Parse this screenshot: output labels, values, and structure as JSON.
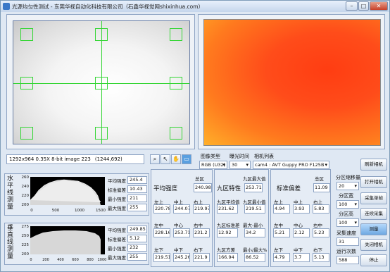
{
  "window": {
    "title": "光源均匀性测试 - 东莞华视自动化科技有限公司（石鑫华视觉网shixinhua.com）",
    "minimize": "–",
    "maximize": "□",
    "close": "✕"
  },
  "status": {
    "image_info": "1292x964 0.35X 8-bit image 223",
    "coords": "(1244,692)"
  },
  "tools": [
    "zoom-icon",
    "pointer-icon",
    "pan-icon",
    "roi-icon"
  ],
  "camera": {
    "type_label": "图像类型",
    "type_value": "RGB (U32)",
    "exposure_label": "曝光时间",
    "exposure_value": "30",
    "list_label": "相机列表",
    "camera_value": "cam4 : AVT Guppy PRO F125B",
    "refresh": "刷新相机"
  },
  "horizontal_profile": {
    "label": "水平线测量",
    "y_ticks": [
      "260",
      "240",
      "220",
      "200"
    ],
    "x_ticks": [
      "0",
      "500",
      "1000",
      "1500"
    ],
    "stats": [
      {
        "k": "平均强度",
        "v": "245.4"
      },
      {
        "k": "标准偏差",
        "v": "10.43"
      },
      {
        "k": "最小强度",
        "v": "211"
      },
      {
        "k": "最大强度",
        "v": "255"
      }
    ]
  },
  "vertical_profile": {
    "label": "垂直线测量",
    "y_ticks": [
      "275",
      "250",
      "225",
      "200"
    ],
    "x_ticks": [
      "0",
      "200",
      "400",
      "600",
      "800",
      "1000"
    ],
    "stats": [
      {
        "k": "平均强度",
        "v": "249.85"
      },
      {
        "k": "标准偏差",
        "v": "5.12"
      },
      {
        "k": "最小强度",
        "v": "232"
      },
      {
        "k": "最大强度",
        "v": "255"
      }
    ]
  },
  "avg_intensity": {
    "title": "平均强度",
    "total_label": "总区",
    "total": "240.98",
    "cells": [
      {
        "k": "左上",
        "v": "220.78"
      },
      {
        "k": "中上",
        "v": "244.07"
      },
      {
        "k": "右上",
        "v": "219.97"
      },
      {
        "k": "左中",
        "v": "228.16"
      },
      {
        "k": "中心",
        "v": "253.71"
      },
      {
        "k": "右中",
        "v": "231.2"
      },
      {
        "k": "左下",
        "v": "219.51"
      },
      {
        "k": "中下",
        "v": "245.26"
      },
      {
        "k": "右下",
        "v": "221.9"
      }
    ]
  },
  "nine_zone": {
    "title": "九区特性",
    "cells": [
      {
        "k": "九区最大值",
        "v": "253.71"
      },
      {
        "k": "九区平均值",
        "v": "231.62"
      },
      {
        "k": "九区最小值",
        "v": "219.51"
      },
      {
        "k": "九区标准差",
        "v": "12.92"
      },
      {
        "k": "最大-最小",
        "v": "34.2"
      },
      {
        "k": "九区方差",
        "v": "166.94"
      },
      {
        "k": "最小/最大%",
        "v": "86.52"
      }
    ]
  },
  "std_dev": {
    "title": "标准偏差",
    "total_label": "总区",
    "total": "11.09",
    "cells": [
      {
        "k": "左上",
        "v": "4.94"
      },
      {
        "k": "中上",
        "v": "3.93"
      },
      {
        "k": "右上",
        "v": "5.83"
      },
      {
        "k": "左中",
        "v": "5.21"
      },
      {
        "k": "中心",
        "v": "2.12"
      },
      {
        "k": "右中",
        "v": "5.23"
      },
      {
        "k": "左下",
        "v": "4.79"
      },
      {
        "k": "中下",
        "v": "3.7"
      },
      {
        "k": "右下",
        "v": "5.13"
      }
    ]
  },
  "zones": {
    "shrink_label": "分区缩移量",
    "shrink": "20",
    "width_label": "分区宽",
    "width": "100",
    "height_label": "分区高",
    "height": "100",
    "speed_label": "采集速度",
    "speed": "31",
    "runs_label": "运行次数",
    "runs": "588"
  },
  "actions": {
    "open": "打开相机",
    "single": "采集单帧",
    "continuous": "连续采集",
    "measure": "测量",
    "close": "关闭相机",
    "stop": "停止"
  }
}
